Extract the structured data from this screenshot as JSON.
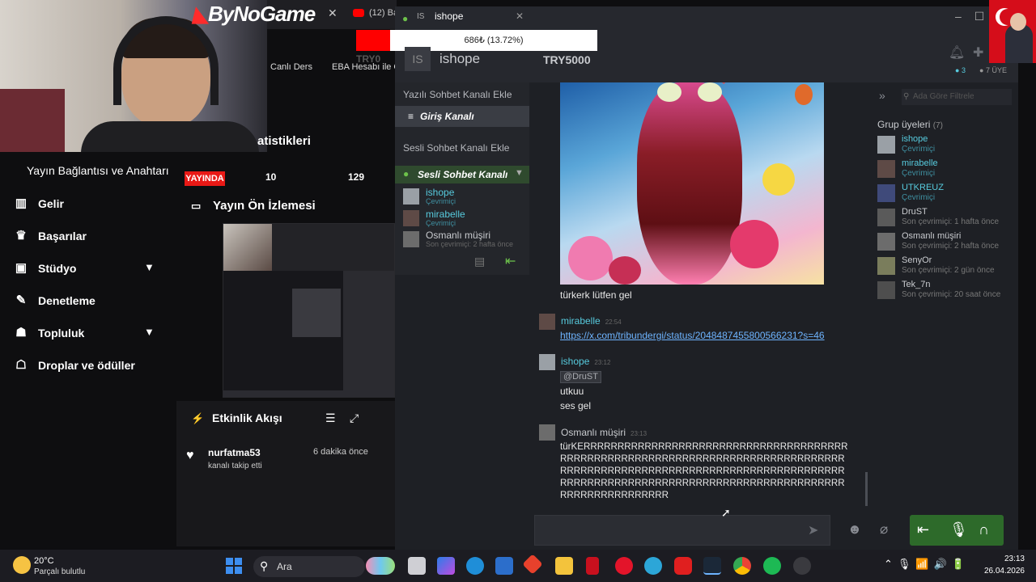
{
  "browser": {
    "logo_text": "ByNoGame",
    "youtube_tab": "(12) Ba",
    "bookmarks": [
      "Canlı Ders",
      "EBA Hesabı ile Gi"
    ],
    "donation_label": "686₺ (13.72%)",
    "donation_percent": 13.72,
    "try_label": "TRY0"
  },
  "twitch": {
    "stats_title": "atistikleri",
    "stream_key": "Yayın Bağlantısı ve Anahtarı",
    "nav": [
      {
        "label": "Gelir",
        "icon": "chart-icon",
        "expandable": false
      },
      {
        "label": "Başarılar",
        "icon": "trophy-icon",
        "expandable": false
      },
      {
        "label": "Stüdyo",
        "icon": "camera-icon",
        "expandable": true
      },
      {
        "label": "Denetleme",
        "icon": "wrench-icon",
        "expandable": false
      },
      {
        "label": "Topluluk",
        "icon": "people-icon",
        "expandable": true
      },
      {
        "label": "Droplar ve ödüller",
        "icon": "gift-icon",
        "expandable": false
      }
    ],
    "live_badge": "YAYINDA",
    "viewers": "10",
    "followers": "129",
    "preview_title": "Yayın Ön İzlemesi",
    "activity_title": "Etkinlik Akışı",
    "activity": {
      "user": "nurfatma53",
      "action": "kanalı takip etti",
      "time": "6 dakika önce"
    }
  },
  "steam": {
    "tab_initials": "IS",
    "tab_name": "ishope",
    "header_initials": "IS",
    "header_name": "ishope",
    "header_balance": "TRY5000",
    "notif_count": "3",
    "online_count": "7 ÜYE",
    "channels": {
      "add_text": "Yazılı Sohbet Kanalı Ekle",
      "text_channel": "Giriş Kanalı",
      "add_voice": "Sesli Sohbet Kanalı Ekle",
      "voice_channel": "Sesli Sohbet Kanalı",
      "voice_users": [
        {
          "name": "ishope",
          "status": "Çevrimiçi",
          "color": "#57cbde"
        },
        {
          "name": "mirabelle",
          "status": "Çevrimiçi",
          "color": "#57cbde"
        },
        {
          "name": "Osmanlı müşiri",
          "status": "Son çevrimiçi: 2 hafta önce",
          "color": "#c9cbcf"
        }
      ]
    },
    "chat": {
      "messages": [
        {
          "text": "türkerk lütfen gel"
        },
        {
          "author": "mirabelle",
          "time": "22:54",
          "link": "https://x.com/tribundergi/status/2048487455800566231?s=46"
        },
        {
          "author": "ishope",
          "time": "23:12",
          "mention": "@DruST",
          "lines": [
            "utkuu",
            "ses gel"
          ]
        },
        {
          "author": "Osmanlı müşiri",
          "time": "23:13",
          "text": "türKERRRRRRRRRRRRRRRRRRRRRRRRRRRRRRRRRRRRRRRRRRRRRRRRRRRRRRRRRRRRRRRRRRRRRRRRRRRRRRRRRRRRRRRRRRRRRRRRRRRRRRRRRRRRRRRRRRRRRRRRRRRRRRRRRRRRRRRRRRRRRRRRRRRRRRRRRRRRRRRRRRRRRRRRRRRRRRRRRRRRR"
        }
      ]
    },
    "members": {
      "filter_placeholder": "Ada Göre Filtrele",
      "title": "Grup üyeleri",
      "count": "(7)",
      "list": [
        {
          "name": "ishope",
          "status": "Çevrimiçi",
          "online": true
        },
        {
          "name": "mirabelle",
          "status": "Çevrimiçi",
          "online": true
        },
        {
          "name": "UTKREUZ",
          "status": "Çevrimiçi",
          "online": true
        },
        {
          "name": "DruST",
          "status": "Son çevrimiçi: 1 hafta önce",
          "online": false
        },
        {
          "name": "Osmanlı müşiri",
          "status": "Son çevrimiçi: 2 hafta önce",
          "online": false
        },
        {
          "name": "SenyOr",
          "status": "Son çevrimiçi: 2 gün önce",
          "online": false
        },
        {
          "name": "Tek_7n",
          "status": "Son çevrimiçi: 20 saat önce",
          "online": false
        }
      ]
    },
    "colors": {
      "online": "#57cbde",
      "offline": "#c9cbcf",
      "voice_green": "#2d6a2a",
      "link": "#6eb4ff"
    }
  },
  "taskbar": {
    "temperature": "20°C",
    "weather": "Parçalı bulutlu",
    "search": "Ara",
    "time": "23:13",
    "date": "26.04.2026"
  }
}
